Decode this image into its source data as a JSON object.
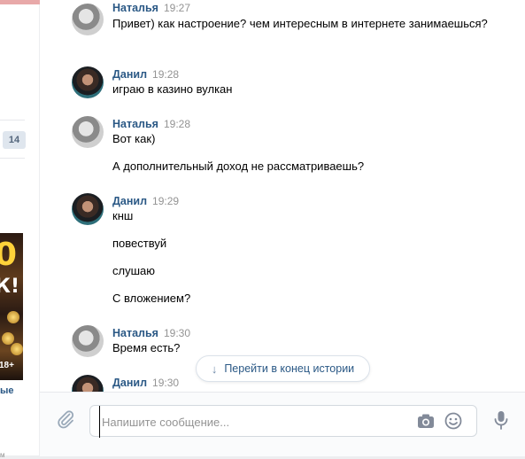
{
  "sidebar": {
    "counter": "14",
    "ad": {
      "line1": "0",
      "line2": "К!",
      "age": "18+"
    },
    "link_fragment": "ые",
    "date_fragment": "м"
  },
  "messages": [
    {
      "author": "Наталья",
      "time": "19:27",
      "avatar": "natalya-avatar",
      "lines": [
        "Привет) как настроение? чем интересным в интернете занимаешься?"
      ]
    },
    {
      "author": "Данил",
      "time": "19:28",
      "avatar": "danil-avatar",
      "lines": [
        "играю в казино вулкан"
      ]
    },
    {
      "author": "Наталья",
      "time": "19:28",
      "avatar": "natalya-avatar",
      "lines": [
        "Вот как)",
        "А дополнительный доход не рассматриваешь?"
      ]
    },
    {
      "author": "Данил",
      "time": "19:29",
      "avatar": "danil-avatar",
      "lines": [
        "кнш",
        "повествуй",
        "слушаю",
        "С вложением?"
      ]
    },
    {
      "author": "Наталья",
      "time": "19:30",
      "avatar": "natalya-avatar",
      "lines": [
        "Время есть?"
      ]
    },
    {
      "author": "Данил",
      "time": "19:30",
      "avatar": "danil-avatar",
      "lines": []
    }
  ],
  "jump_button": {
    "label": "Перейти в конец истории",
    "icon": "arrow-down-icon"
  },
  "composer": {
    "placeholder": "Напишите сообщение...",
    "value": "",
    "icons": [
      "paperclip-icon",
      "camera-icon",
      "smile-icon",
      "microphone-icon"
    ]
  },
  "colors": {
    "link": "#2a5885",
    "muted": "#939393",
    "border": "#d3d9de",
    "bg": "#edeef0"
  }
}
